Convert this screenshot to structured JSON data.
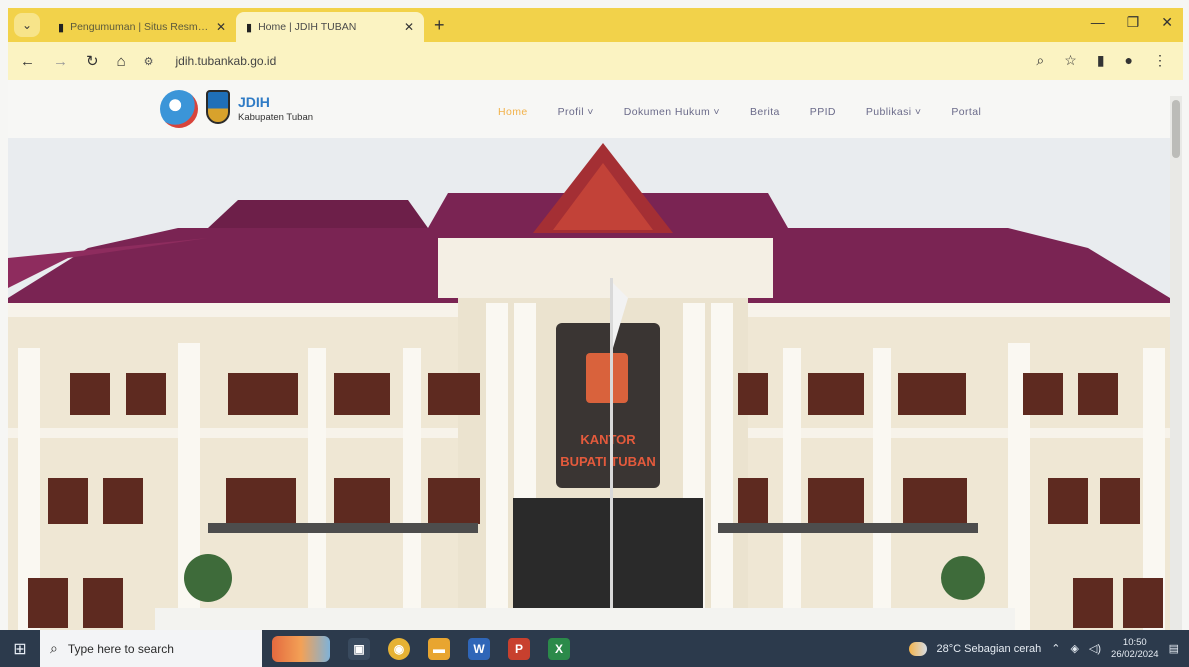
{
  "browser": {
    "tabs": [
      {
        "title": "Pengumuman | Situs Resmi Pe",
        "active": false
      },
      {
        "title": "Home | JDIH TUBAN",
        "active": true
      }
    ],
    "url": "jdih.tubankab.go.id",
    "tab_menu_icon": "chevron-down-icon",
    "newtab_label": "+",
    "window_controls": [
      "minimize-icon",
      "restore-icon",
      "close-icon"
    ],
    "accent_color": "#f2d24a"
  },
  "site": {
    "brand_title": "JDIH",
    "brand_subtitle": "Kabupaten Tuban",
    "nav": [
      {
        "label": "Home",
        "active": true
      },
      {
        "label": "Profil ˅",
        "active": false
      },
      {
        "label": "Dokumen Hukum ˅",
        "active": false
      },
      {
        "label": "Berita",
        "active": false
      },
      {
        "label": "PPID",
        "active": false
      },
      {
        "label": "Publikasi ˅",
        "active": false
      },
      {
        "label": "Portal",
        "active": false
      }
    ],
    "hero": {
      "sign_line1": "KANTOR",
      "sign_line2": "BUPATI TUBAN"
    }
  },
  "taskbar": {
    "search_placeholder": "Type here to search",
    "weather": "28°C  Sebagian cerah",
    "time": "10:50",
    "date": "26/02/2024",
    "app_icons": [
      "taskview-icon",
      "chrome-icon",
      "files-icon",
      "word-icon",
      "powerpoint-icon",
      "excel-icon"
    ]
  }
}
